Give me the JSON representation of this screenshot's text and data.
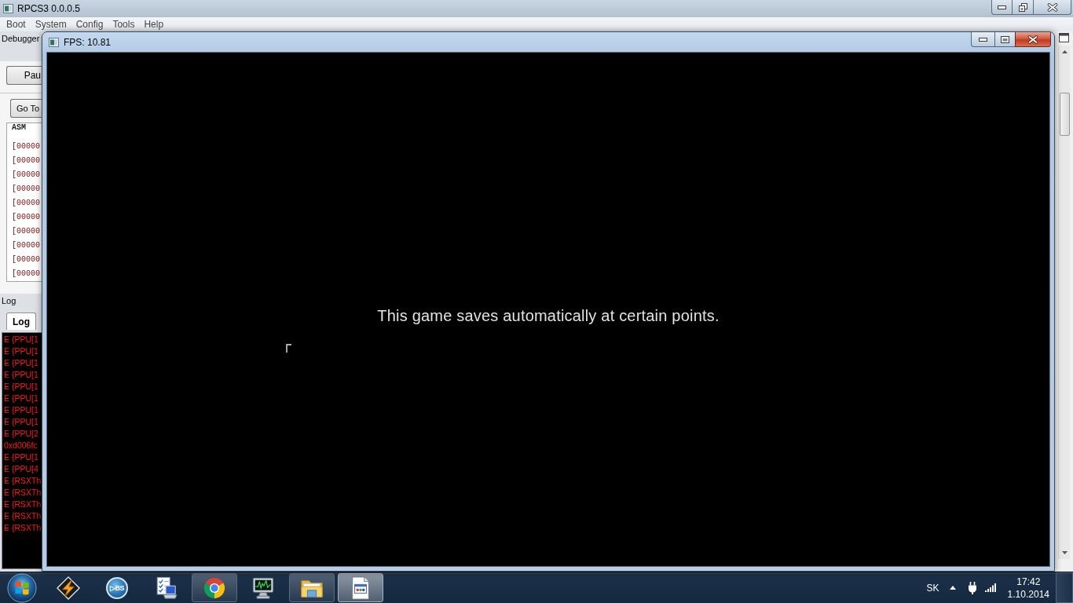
{
  "main_window": {
    "title": "RPCS3 0.0.0.5",
    "menu": [
      "Boot",
      "System",
      "Config",
      "Tools",
      "Help"
    ]
  },
  "debugger_panel": {
    "title": "Debugger",
    "pause_button": "Pau",
    "goto_button": "Go To",
    "asm_list": {
      "header": "ASM",
      "rows": [
        "[00000",
        "[00000",
        "[00000",
        "[00000",
        "[00000",
        "[00000",
        "[00000",
        "[00000",
        "[00000",
        "[00000"
      ]
    }
  },
  "log_panel": {
    "title": "Log",
    "tabs": [
      {
        "label": "Log",
        "selected": true
      }
    ],
    "lines": [
      "E {PPU[1",
      "E {PPU[1",
      "E {PPU[1",
      "E {PPU[1",
      "E {PPU[1",
      "E {PPU[1",
      "E {PPU[1",
      "E {PPU[1",
      "E {PPU[2",
      "0xd006fc",
      "E {PPU[1",
      "E {PPU[4",
      "E {RSXTh",
      "E {RSXTh",
      "E {RSXTh",
      "E {RSXTh",
      "E {RSXTh"
    ]
  },
  "render_window": {
    "title": "FPS: 10.81",
    "message": "This game saves automatically at certain points."
  },
  "taskbar": {
    "apps": [
      {
        "kind": "bolt",
        "running": false,
        "active": false
      },
      {
        "kind": "disc",
        "label": "▷BS",
        "running": false,
        "active": false
      },
      {
        "kind": "checklist",
        "running": false,
        "active": false
      },
      {
        "kind": "wheel",
        "running": true,
        "active": false
      },
      {
        "kind": "monitor",
        "running": false,
        "active": false
      },
      {
        "kind": "folder",
        "running": true,
        "active": false
      },
      {
        "kind": "document",
        "running": true,
        "active": true
      }
    ],
    "tray": {
      "language": "SK",
      "time": "17:42",
      "date": "1.10.2014"
    }
  }
}
